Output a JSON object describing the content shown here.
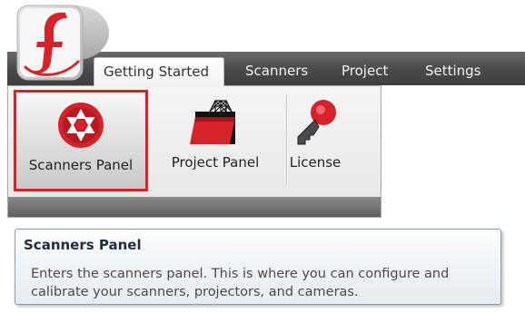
{
  "ribbon": {
    "tabs": [
      {
        "label": "Getting Started",
        "active": true
      },
      {
        "label": "Scanners",
        "active": false
      },
      {
        "label": "Project",
        "active": false
      },
      {
        "label": "Settings",
        "active": false
      }
    ],
    "buttons": {
      "scanners_panel": {
        "label": "Scanners Panel",
        "icon": "camera-aperture-icon",
        "highlighted": true
      },
      "project_panel": {
        "label": "Project Panel",
        "icon": "project-folder-icon"
      },
      "license": {
        "label": "License",
        "icon": "key-icon"
      }
    }
  },
  "tooltip": {
    "title": "Scanners Panel",
    "body": "Enters the scanners panel.  This is where you can configure and calibrate your scanners, projectors, and cameras."
  },
  "colors": {
    "accent_red": "#d8222a",
    "ribbon_dark": "#4d4d4d",
    "highlight_border": "#d8222a"
  }
}
